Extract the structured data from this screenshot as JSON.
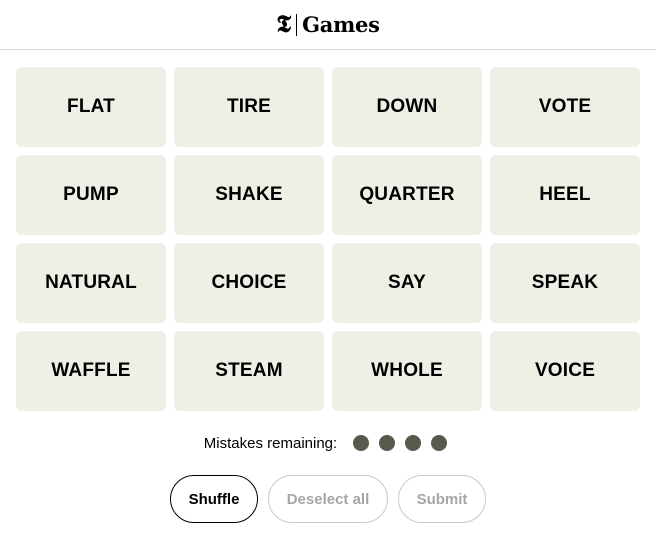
{
  "header": {
    "logo_glyph": "𝕿",
    "brand_name": "Games"
  },
  "board": {
    "tiles": [
      "FLAT",
      "TIRE",
      "DOWN",
      "VOTE",
      "PUMP",
      "SHAKE",
      "QUARTER",
      "HEEL",
      "NATURAL",
      "CHOICE",
      "SAY",
      "SPEAK",
      "WAFFLE",
      "STEAM",
      "WHOLE",
      "VOICE"
    ],
    "tile_color": "#efefe6"
  },
  "mistakes": {
    "label": "Mistakes remaining:",
    "remaining": 4,
    "dot_color": "#5a594e"
  },
  "actions": {
    "shuffle_label": "Shuffle",
    "deselect_label": "Deselect all",
    "submit_label": "Submit"
  }
}
